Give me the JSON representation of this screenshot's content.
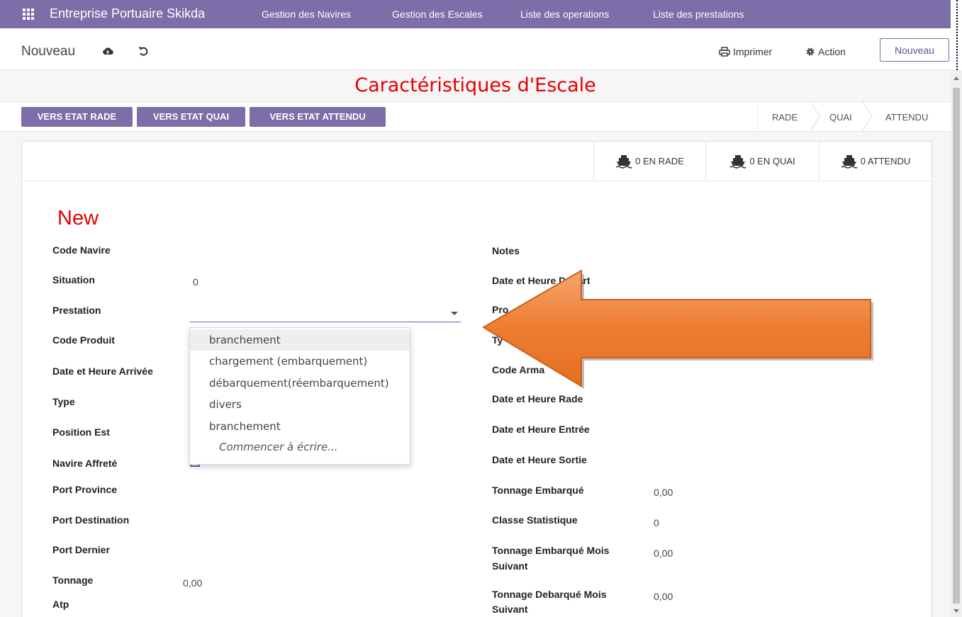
{
  "navbar": {
    "brand": "Entreprise Portuaire Skikda",
    "menus": [
      "Gestion des Navires",
      "Gestion des Escales",
      "Liste des operations",
      "Liste des prestations"
    ]
  },
  "control": {
    "breadcrumb": "Nouveau",
    "print_label": "Imprimer",
    "action_label": "Action",
    "new_label": "Nouveau"
  },
  "page_title": "Caractéristiques d'Escale",
  "status_buttons": [
    "VERS ETAT RADE",
    "VERS ETAT QUAI",
    "VERS ETAT ATTENDU"
  ],
  "stages": [
    "RADE",
    "QUAI",
    "ATTENDU"
  ],
  "smart_buttons": [
    "0 EN RADE",
    "0 EN QUAI",
    "0 ATTENDU"
  ],
  "record_name": "New",
  "left_fields": {
    "code_navire": "Code Navire",
    "situation": "Situation",
    "situation_value": "0",
    "prestation": "Prestation",
    "code_produit": "Code Produit",
    "date_arrivee": "Date et Heure Arrivée",
    "type": "Type",
    "position_est": "Position Est",
    "navire_affrete": "Navire Affreté",
    "port_province": "Port Province",
    "port_destination": "Port Destination",
    "port_dernier": "Port Dernier",
    "tonnage": "Tonnage",
    "tonnage_value": "0,00",
    "atp": "Atp"
  },
  "right_fields": {
    "notes": "Notes",
    "date_depart": "Date et Heure Depart",
    "prod": "Pro",
    "typ": "Ty",
    "code_arm": "Code Arma",
    "date_rade": "Date et Heure Rade",
    "date_entree": "Date et Heure Entrée",
    "date_sortie": "Date et Heure Sortie",
    "tonnage_embarque": "Tonnage Embarqué",
    "tonnage_embarque_value": "0,00",
    "classe_statistique": "Classe Statistique",
    "classe_statistique_value": "0",
    "tonnage_embarque_mois_1": "Tonnage Embarqué Mois",
    "tonnage_embarque_mois_2": "Suivant",
    "tonnage_embarque_mois_value": "0,00",
    "tonnage_debarque_mois_1": "Tonnage Debarqué Mois",
    "tonnage_debarque_mois_2": "Suivant",
    "tonnage_debarque_mois_value": "0,00"
  },
  "dropdown": {
    "options": [
      "branchement",
      "chargement (embarquement)",
      "débarquement(réembarquement)",
      "divers",
      "branchement"
    ],
    "hint": "Commencer à écrire..."
  },
  "colors": {
    "navbar": "#7c6ea8",
    "title_red": "#e60000",
    "arrow_orange": "#ee7d31"
  },
  "icons": [
    "apps-grid-icon",
    "cloud-upload-icon",
    "undo-icon",
    "printer-icon",
    "gear-icon",
    "ship-icon"
  ]
}
